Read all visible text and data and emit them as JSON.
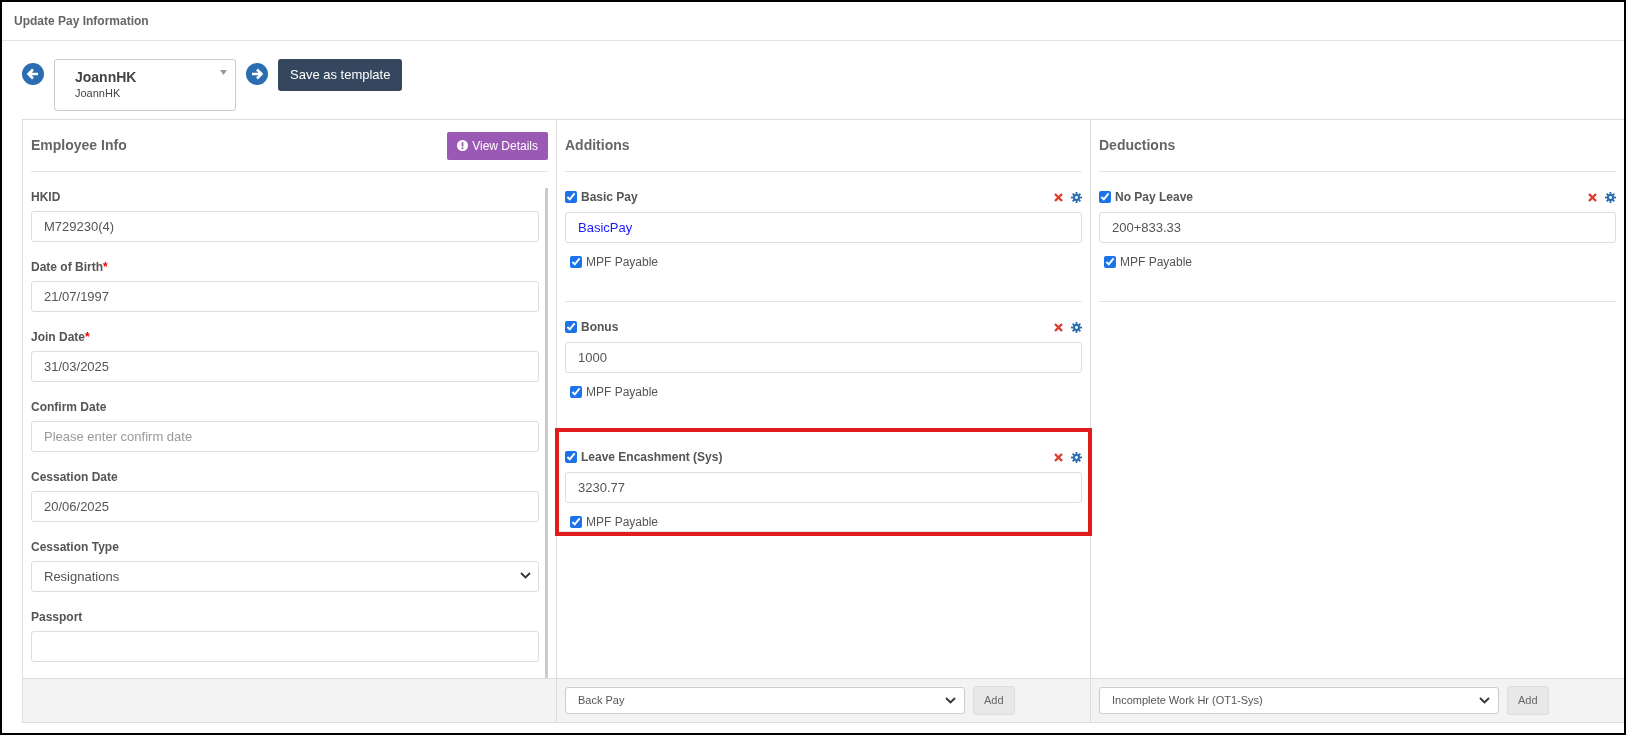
{
  "page_title": "Update Pay Information",
  "employee_picker": {
    "name": "JoannHK",
    "subtitle": "JoannHK"
  },
  "save_template_button": "Save as template",
  "employee_info": {
    "title": "Employee Info",
    "view_details_button": "View Details",
    "fields": [
      {
        "label": "HKID",
        "kind": "text",
        "value": "M729230(4)"
      },
      {
        "label": "Date of Birth",
        "required_mark": "*",
        "kind": "text",
        "value": "21/07/1997"
      },
      {
        "label": "Join Date",
        "required_mark": "*",
        "kind": "text",
        "value": "31/03/2025"
      },
      {
        "label": "Confirm Date",
        "kind": "text",
        "placeholder": "Please enter confirm date"
      },
      {
        "label": "Cessation Date",
        "kind": "text",
        "value": "20/06/2025"
      },
      {
        "label": "Cessation Type",
        "kind": "select",
        "value": "Resignations"
      },
      {
        "label": "Passport",
        "kind": "text"
      }
    ]
  },
  "additions": {
    "title": "Additions",
    "items": [
      {
        "name": "Basic Pay",
        "checked": true,
        "kind": "formula",
        "value": "BasicPay",
        "mpf_label": "MPF Payable",
        "mpf_checked": true,
        "highlighted": false
      },
      {
        "name": "Bonus",
        "checked": true,
        "kind": "amount",
        "value": "1000",
        "mpf_label": "MPF Payable",
        "mpf_checked": true,
        "highlighted": false
      },
      {
        "name": "Leave Encashment (Sys)",
        "checked": true,
        "kind": "amount",
        "value": "3230.77",
        "mpf_label": "MPF Payable",
        "mpf_checked": true,
        "highlighted": true
      }
    ],
    "add_select": "Back Pay",
    "add_button": "Add"
  },
  "deductions": {
    "title": "Deductions",
    "items": [
      {
        "name": "No Pay Leave",
        "checked": true,
        "kind": "amount",
        "value": "200+833.33",
        "mpf_label": "MPF Payable",
        "mpf_checked": true,
        "highlighted": false
      }
    ],
    "add_select": "Incomplete Work Hr (OT1-Sys)",
    "add_button": "Add"
  }
}
